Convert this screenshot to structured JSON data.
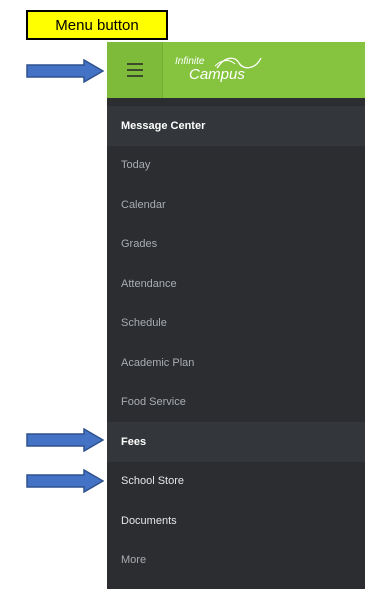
{
  "annotation": {
    "label": "Menu button"
  },
  "topbar": {
    "menu_icon": "hamburger-icon",
    "logo_line1": "Infinite",
    "logo_line2": "Campus"
  },
  "nav": {
    "items": [
      {
        "label": "Message Center"
      },
      {
        "label": "Today"
      },
      {
        "label": "Calendar"
      },
      {
        "label": "Grades"
      },
      {
        "label": "Attendance"
      },
      {
        "label": "Schedule"
      },
      {
        "label": "Academic Plan"
      },
      {
        "label": "Food Service"
      },
      {
        "label": "Fees"
      },
      {
        "label": "School Store"
      },
      {
        "label": "Documents"
      },
      {
        "label": "More"
      }
    ]
  },
  "colors": {
    "topbar": "#86c440",
    "sidebar": "#2b2d30",
    "annotation_bg": "#ffff00",
    "arrow": "#4472c4"
  }
}
